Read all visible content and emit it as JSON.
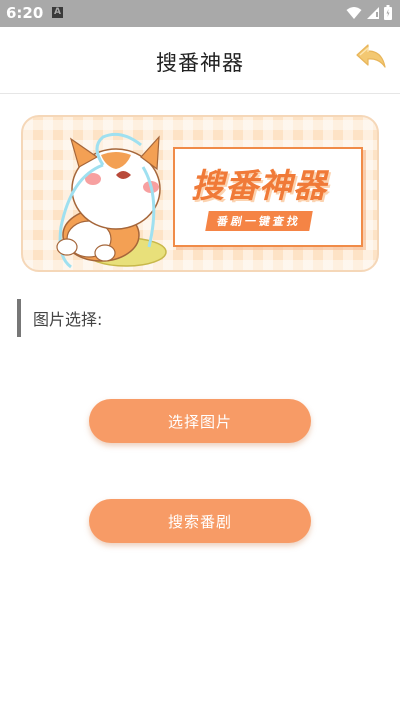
{
  "status_bar": {
    "time": "6:20",
    "notification_letter": "A",
    "icons": [
      "wifi-icon",
      "signal-icon",
      "battery-icon"
    ]
  },
  "header": {
    "title": "搜番神器",
    "back_icon": "back-arrow-icon"
  },
  "banner": {
    "title": "搜番神器",
    "tagline": "番剧一键查找",
    "mascot": "crying-cat-illustration"
  },
  "section": {
    "label": "图片选择:"
  },
  "buttons": {
    "select_image": "选择图片",
    "search_anime": "搜索番剧"
  },
  "colors": {
    "accent": "#f79b66",
    "banner_title": "#f07a38",
    "status_bar": "#a9a9a9"
  }
}
